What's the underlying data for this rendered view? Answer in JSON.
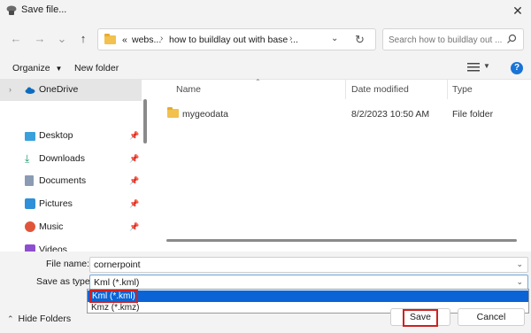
{
  "window": {
    "title": "Save file..."
  },
  "navigation": {
    "breadcrumbs": [
      "«",
      "webs...",
      "how to buildlay out with base ..."
    ],
    "search_placeholder": "Search how to buildlay out ..."
  },
  "toolbar": {
    "organize_label": "Organize",
    "new_folder_label": "New folder",
    "help_label": "?"
  },
  "sidebar": {
    "items": [
      {
        "label": "OneDrive",
        "icon": "cloud-icon"
      },
      {
        "label": "Desktop",
        "icon": "desktop-icon"
      },
      {
        "label": "Downloads",
        "icon": "download-icon"
      },
      {
        "label": "Documents",
        "icon": "documents-icon"
      },
      {
        "label": "Pictures",
        "icon": "pictures-icon"
      },
      {
        "label": "Music",
        "icon": "music-icon"
      },
      {
        "label": "Videos",
        "icon": "videos-icon"
      }
    ]
  },
  "file_list": {
    "columns": [
      "Name",
      "Date modified",
      "Type"
    ],
    "rows": [
      {
        "name": "mygeodata",
        "date": "8/2/2023 10:50 AM",
        "type": "File folder"
      }
    ]
  },
  "save_panel": {
    "file_name_label": "File name:",
    "file_name_value": "cornerpoint",
    "save_as_type_label": "Save as type:",
    "save_as_type_value": "Kml (*.kml)",
    "type_options": [
      "Kml (*.kml)",
      "Kmz (*.kmz)"
    ],
    "hide_folders_label": "Hide Folders",
    "save_button": "Save",
    "cancel_button": "Cancel"
  },
  "colors": {
    "accent": "#0a64d6",
    "highlight_box": "#cc2222",
    "folder": "#f2c14e"
  }
}
